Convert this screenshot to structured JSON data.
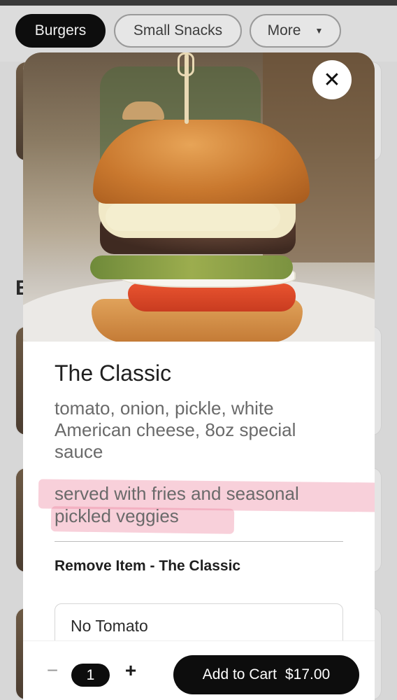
{
  "categories": {
    "chips": [
      {
        "label": "Burgers",
        "active": true
      },
      {
        "label": "Small Snacks",
        "active": false
      },
      {
        "label": "More",
        "active": false
      }
    ]
  },
  "background": {
    "section_letter": "E"
  },
  "modal": {
    "close_icon": "close-icon",
    "item": {
      "title": "The Classic",
      "description": "tomato, onion, pickle, white American cheese, 8oz special sauce",
      "note": "served with fries and seasonal pickled veggies"
    },
    "modifiers": {
      "section_title": "Remove Item - The Classic",
      "options": [
        {
          "label": "No Tomato"
        }
      ]
    }
  },
  "cart_bar": {
    "quantity": "1",
    "minus_label": "−",
    "plus_label": "+",
    "add_label": "Add to Cart",
    "price": "$17.00"
  },
  "colors": {
    "accent": "#0d0d0d",
    "highlight": "#ec7896"
  }
}
